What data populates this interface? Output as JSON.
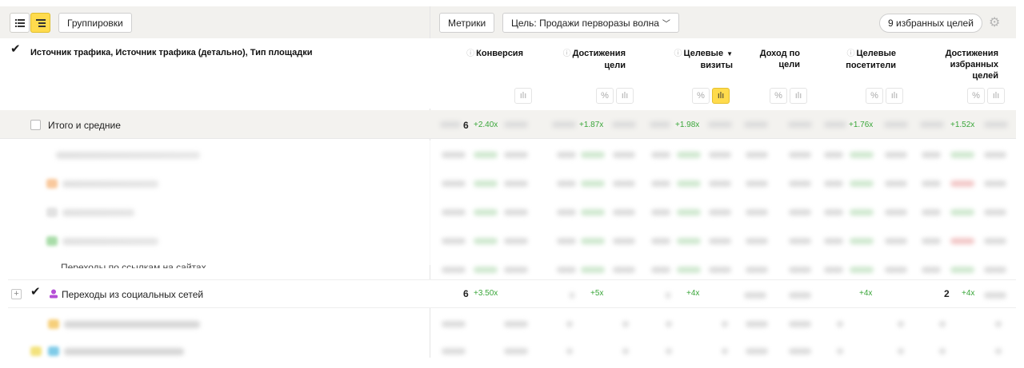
{
  "toolbar": {
    "groupings_label": "Группировки",
    "metrics_label": "Метрики",
    "goal_select_label": "Цель: Продажи перворазы волна",
    "favorite_goals_label": "9 избранных целей"
  },
  "table": {
    "dimension_header": "Источник трафика, Источник трафика (детально), Тип площадки",
    "columns": [
      {
        "line1": "Конверсия",
        "line2": "",
        "line3": "",
        "info": true
      },
      {
        "line1": "Достижения",
        "line2": "цели",
        "line3": "",
        "info": true
      },
      {
        "line1": "Целевые",
        "line2": "визиты",
        "line3": "",
        "info": true,
        "sorted": true
      },
      {
        "line1": "Доход по",
        "line2": "цели",
        "line3": "",
        "info": false
      },
      {
        "line1": "Целевые",
        "line2": "посетители",
        "line3": "",
        "info": true
      },
      {
        "line1": "Достижения",
        "line2": "избранных",
        "line3": "целей",
        "info": false
      }
    ],
    "percent_symbol": "%",
    "total_row": {
      "label": "Итого и средние",
      "lifts": [
        "+2.40x",
        "+1.87x",
        "+1.98x",
        "+1.76x",
        "+1.52x"
      ],
      "partial_digit": "6"
    },
    "partial_row_label": "Переходы по ссылкам на сайтах",
    "social_row": {
      "label": "Переходы из социальных сетей",
      "lifts": [
        "+3.50x",
        "+5x",
        "+4x",
        "+4x",
        "+4x"
      ],
      "partial_digits": [
        "6",
        "2"
      ]
    }
  },
  "colors": {
    "accent_yellow": "#ffdb4d",
    "lift_green": "#3aa63a",
    "header_bg": "#f2f1ee"
  }
}
